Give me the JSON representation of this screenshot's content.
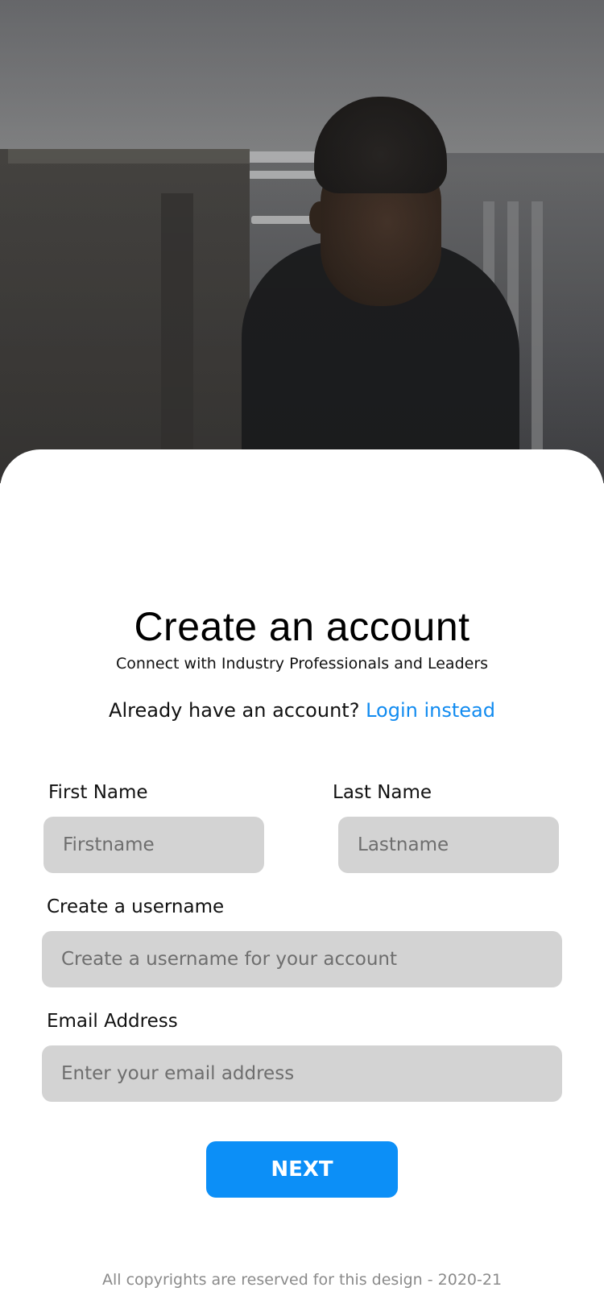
{
  "header": {
    "title": "Create an account",
    "subtitle": "Connect with Industry Professionals and Leaders",
    "login_prompt": "Already have an account?",
    "login_link": "Login instead"
  },
  "form": {
    "first_name": {
      "label": "First Name",
      "placeholder": "Firstname"
    },
    "last_name": {
      "label": "Last Name",
      "placeholder": "Lastname"
    },
    "username": {
      "label": "Create a username",
      "placeholder": "Create a username for your account"
    },
    "email": {
      "label": "Email Address",
      "placeholder": "Enter your email address"
    },
    "next_label": "NEXT"
  },
  "footer": {
    "copyright": "All copyrights are reserved for this design - 2020-21"
  },
  "colors": {
    "accent": "#0c8ff7",
    "link": "#118bf0",
    "field_bg": "#d3d3d3",
    "footer_text": "#8a8a8a"
  }
}
